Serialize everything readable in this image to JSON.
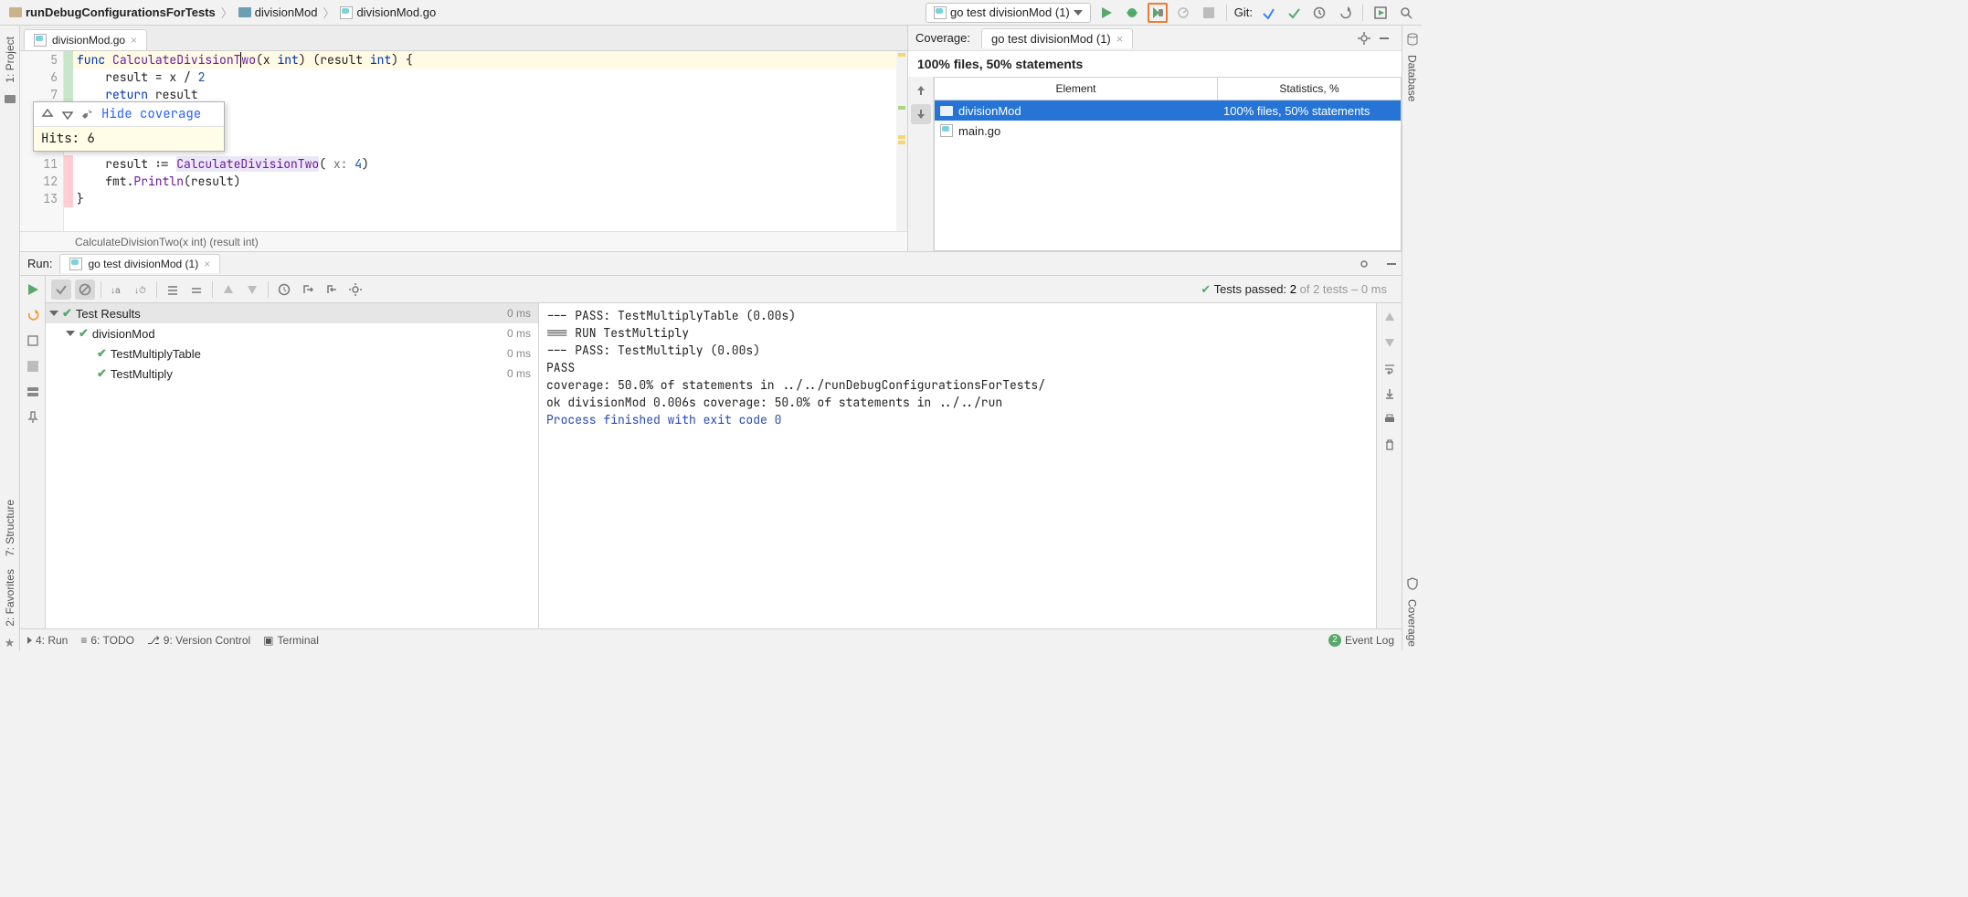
{
  "breadcrumbs": {
    "root": "runDebugConfigurationsForTests",
    "mid": "divisionMod",
    "file": "divisionMod.go"
  },
  "runConfig": "go test divisionMod (1)",
  "gitLabel": "Git:",
  "leftStrip": {
    "project": "1: Project"
  },
  "rightStrip": {
    "database": "Database",
    "coverage": "Coverage"
  },
  "editorTab": "divisionMod.go",
  "code": {
    "l5a": "func ",
    "l5b": "CalculateDivisionT",
    "l5c": "wo",
    "l5d": "(x ",
    "l5e": "int",
    "l5f": ") (result ",
    "l5g": "int",
    "l5h": ") {",
    "l6": "    result = x / ",
    "l6n": "2",
    "l7a": "    ",
    "l7b": "return",
    "l7c": " result",
    "l11a": "    result := ",
    "l11b": "CalculateDivisionTwo",
    "l11c": "(",
    "l11p": " x: ",
    "l11n": "4",
    "l11d": ")",
    "l12a": "    fmt.",
    "l12b": "Println",
    "l12c": "(result)",
    "l13": "}"
  },
  "gutter": {
    "g5": "5",
    "g6": "6",
    "g7": "7",
    "g11": "11",
    "g12": "12",
    "g13": "13"
  },
  "covPopup": {
    "hide": "Hide coverage",
    "hits": "Hits: 6"
  },
  "edStatus": "CalculateDivisionTwo(x int) (result int)",
  "coverage": {
    "label": "Coverage:",
    "tab": "go test divisionMod (1)",
    "summary": "100% files, 50% statements",
    "colElement": "Element",
    "colStats": "Statistics, %",
    "rows": [
      {
        "name": "divisionMod",
        "stats": "100% files, 50% statements",
        "type": "folder"
      },
      {
        "name": "main.go",
        "stats": "",
        "type": "gofile"
      }
    ]
  },
  "run": {
    "label": "Run:",
    "tab": "go test divisionMod (1)",
    "statusPrefix": "Tests passed: ",
    "statusBold": "2",
    "statusSuffix": " of 2 tests – 0 ms",
    "tree": {
      "root": "Test Results",
      "rootTime": "0 ms",
      "pkg": "divisionMod",
      "pkgTime": "0 ms",
      "t1": "TestMultiplyTable",
      "t1Time": "0 ms",
      "t2": "TestMultiply",
      "t2Time": "0 ms"
    },
    "console": {
      "l1": "--- PASS: TestMultiplyTable (0.00s)",
      "l2": "=== RUN   TestMultiply",
      "l3": "--- PASS: TestMultiply (0.00s)",
      "l4": "PASS",
      "l5": "coverage: 50.0% of statements in ../../runDebugConfigurationsForTests/",
      "l6": "ok      divisionMod 0.006s  coverage: 50.0% of statements in ../../run",
      "l7": "",
      "l8": "Process finished with exit code 0"
    }
  },
  "statusBar": {
    "run": "4: Run",
    "todo": "6: TODO",
    "vcs": "9: Version Control",
    "terminal": "Terminal",
    "eventLog": "Event Log",
    "eventCount": "2"
  },
  "leftBottom": {
    "structure": "7: Structure",
    "favorites": "2: Favorites"
  }
}
